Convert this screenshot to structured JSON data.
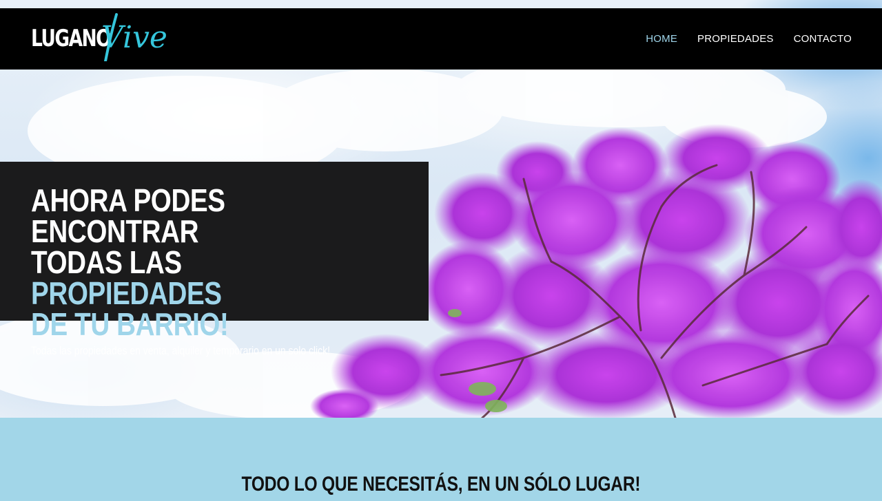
{
  "brand": {
    "name_main": "LUGANO",
    "name_script": "Vive",
    "accent_color": "#35c6dc"
  },
  "nav": {
    "items": [
      {
        "label": "HOME",
        "active": true
      },
      {
        "label": "PROPIEDADES",
        "active": false
      },
      {
        "label": "CONTACTO",
        "active": false
      }
    ]
  },
  "hero": {
    "title_line1": "AHORA PODES ENCONTRAR",
    "title_line2_plain": "TODAS LAS ",
    "title_line2_highlight": "PROPIEDADES",
    "title_line3_highlight": "DE TU BARRIO!",
    "subtitle": "Todas las propiedades en venta, alquiler y temporario en un solo click!",
    "highlight_color": "#9fd5ea",
    "background_image": "jacaranda-tree-against-sky"
  },
  "section": {
    "title": "TODO LO QUE NECESITÁS, EN UN SÓLO LUGAR!",
    "background_color": "#a2d6e8"
  }
}
